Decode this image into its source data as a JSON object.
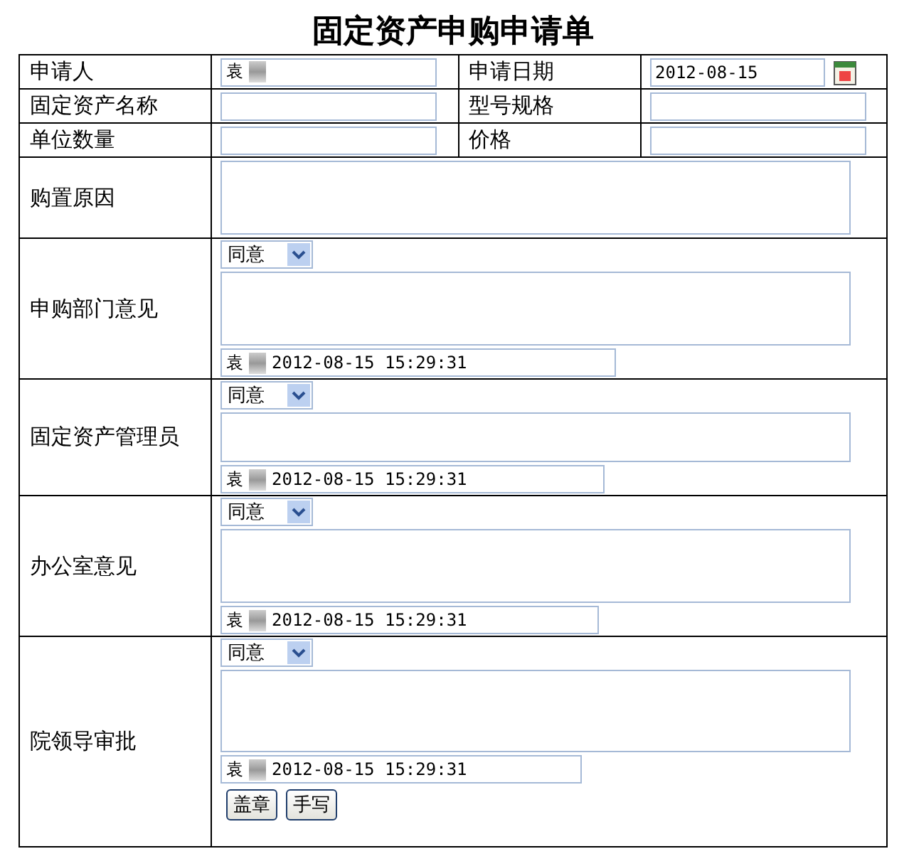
{
  "title": "固定资产申购申请单",
  "rows": [
    [
      {
        "label": "申请人",
        "value": "袁",
        "redacted": true,
        "kind": "text"
      },
      {
        "label": "申请日期",
        "value": "2012-08-15",
        "redacted": false,
        "kind": "date"
      }
    ],
    [
      {
        "label": "固定资产名称",
        "redacted": false,
        "kind": "text"
      },
      {
        "label": "型号规格",
        "redacted": false,
        "kind": "text"
      }
    ],
    [
      {
        "label": "单位数量",
        "redacted": false,
        "kind": "text"
      },
      {
        "label": "价格",
        "redacted": false,
        "kind": "text"
      }
    ]
  ],
  "reason": {
    "label": "购置原因"
  },
  "approvals": [
    {
      "label": "申购部门意见",
      "opinion": "同意",
      "signer": "袁",
      "redacted": true,
      "time": "2012-08-15 15:29:31"
    },
    {
      "label": "固定资产管理员",
      "opinion": "同意",
      "signer": "袁",
      "redacted": true,
      "time": "2012-08-15 15:29:31"
    },
    {
      "label": "办公室意见",
      "opinion": "同意",
      "signer": "袁",
      "redacted": true,
      "time": "2012-08-15 15:29:31"
    },
    {
      "label": "院领导审批",
      "opinion": "同意",
      "signer": "袁",
      "redacted": true,
      "time": "2012-08-15 15:29:31",
      "buttons": [
        "盖章",
        "手写"
      ]
    }
  ]
}
